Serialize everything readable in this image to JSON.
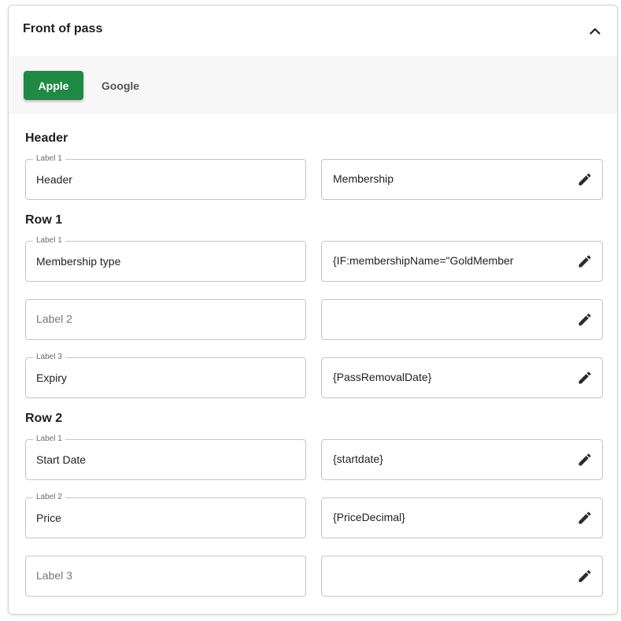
{
  "panel": {
    "title": "Front of pass",
    "collapse_icon": "chevron-up-icon"
  },
  "tabs": [
    {
      "label": "Apple",
      "active": true
    },
    {
      "label": "Google",
      "active": false
    }
  ],
  "colors": {
    "accent": "#1e8a44",
    "tab_bar_bg": "#f7f7f7",
    "border": "#c4c4c4"
  },
  "sections": {
    "header": {
      "title": "Header",
      "rows": [
        {
          "label": "Label 1",
          "value": "Header",
          "placeholder": "",
          "right_value": "Membership"
        }
      ]
    },
    "row1": {
      "title": "Row 1",
      "rows": [
        {
          "label": "Label 1",
          "value": "Membership type",
          "placeholder": "",
          "right_value": "{IF:membershipName=\"GoldMember"
        },
        {
          "label": "",
          "value": "",
          "placeholder": "Label 2",
          "right_value": ""
        },
        {
          "label": "Label 3",
          "value": "Expiry",
          "placeholder": "",
          "right_value": "{PassRemovalDate}"
        }
      ]
    },
    "row2": {
      "title": "Row 2",
      "rows": [
        {
          "label": "Label 1",
          "value": "Start Date",
          "placeholder": "",
          "right_value": "{startdate}"
        },
        {
          "label": "Label 2",
          "value": "Price",
          "placeholder": "",
          "right_value": "{PriceDecimal}"
        },
        {
          "label": "",
          "value": "",
          "placeholder": "Label 3",
          "right_value": ""
        }
      ]
    }
  },
  "edit_icon": "pencil-icon"
}
